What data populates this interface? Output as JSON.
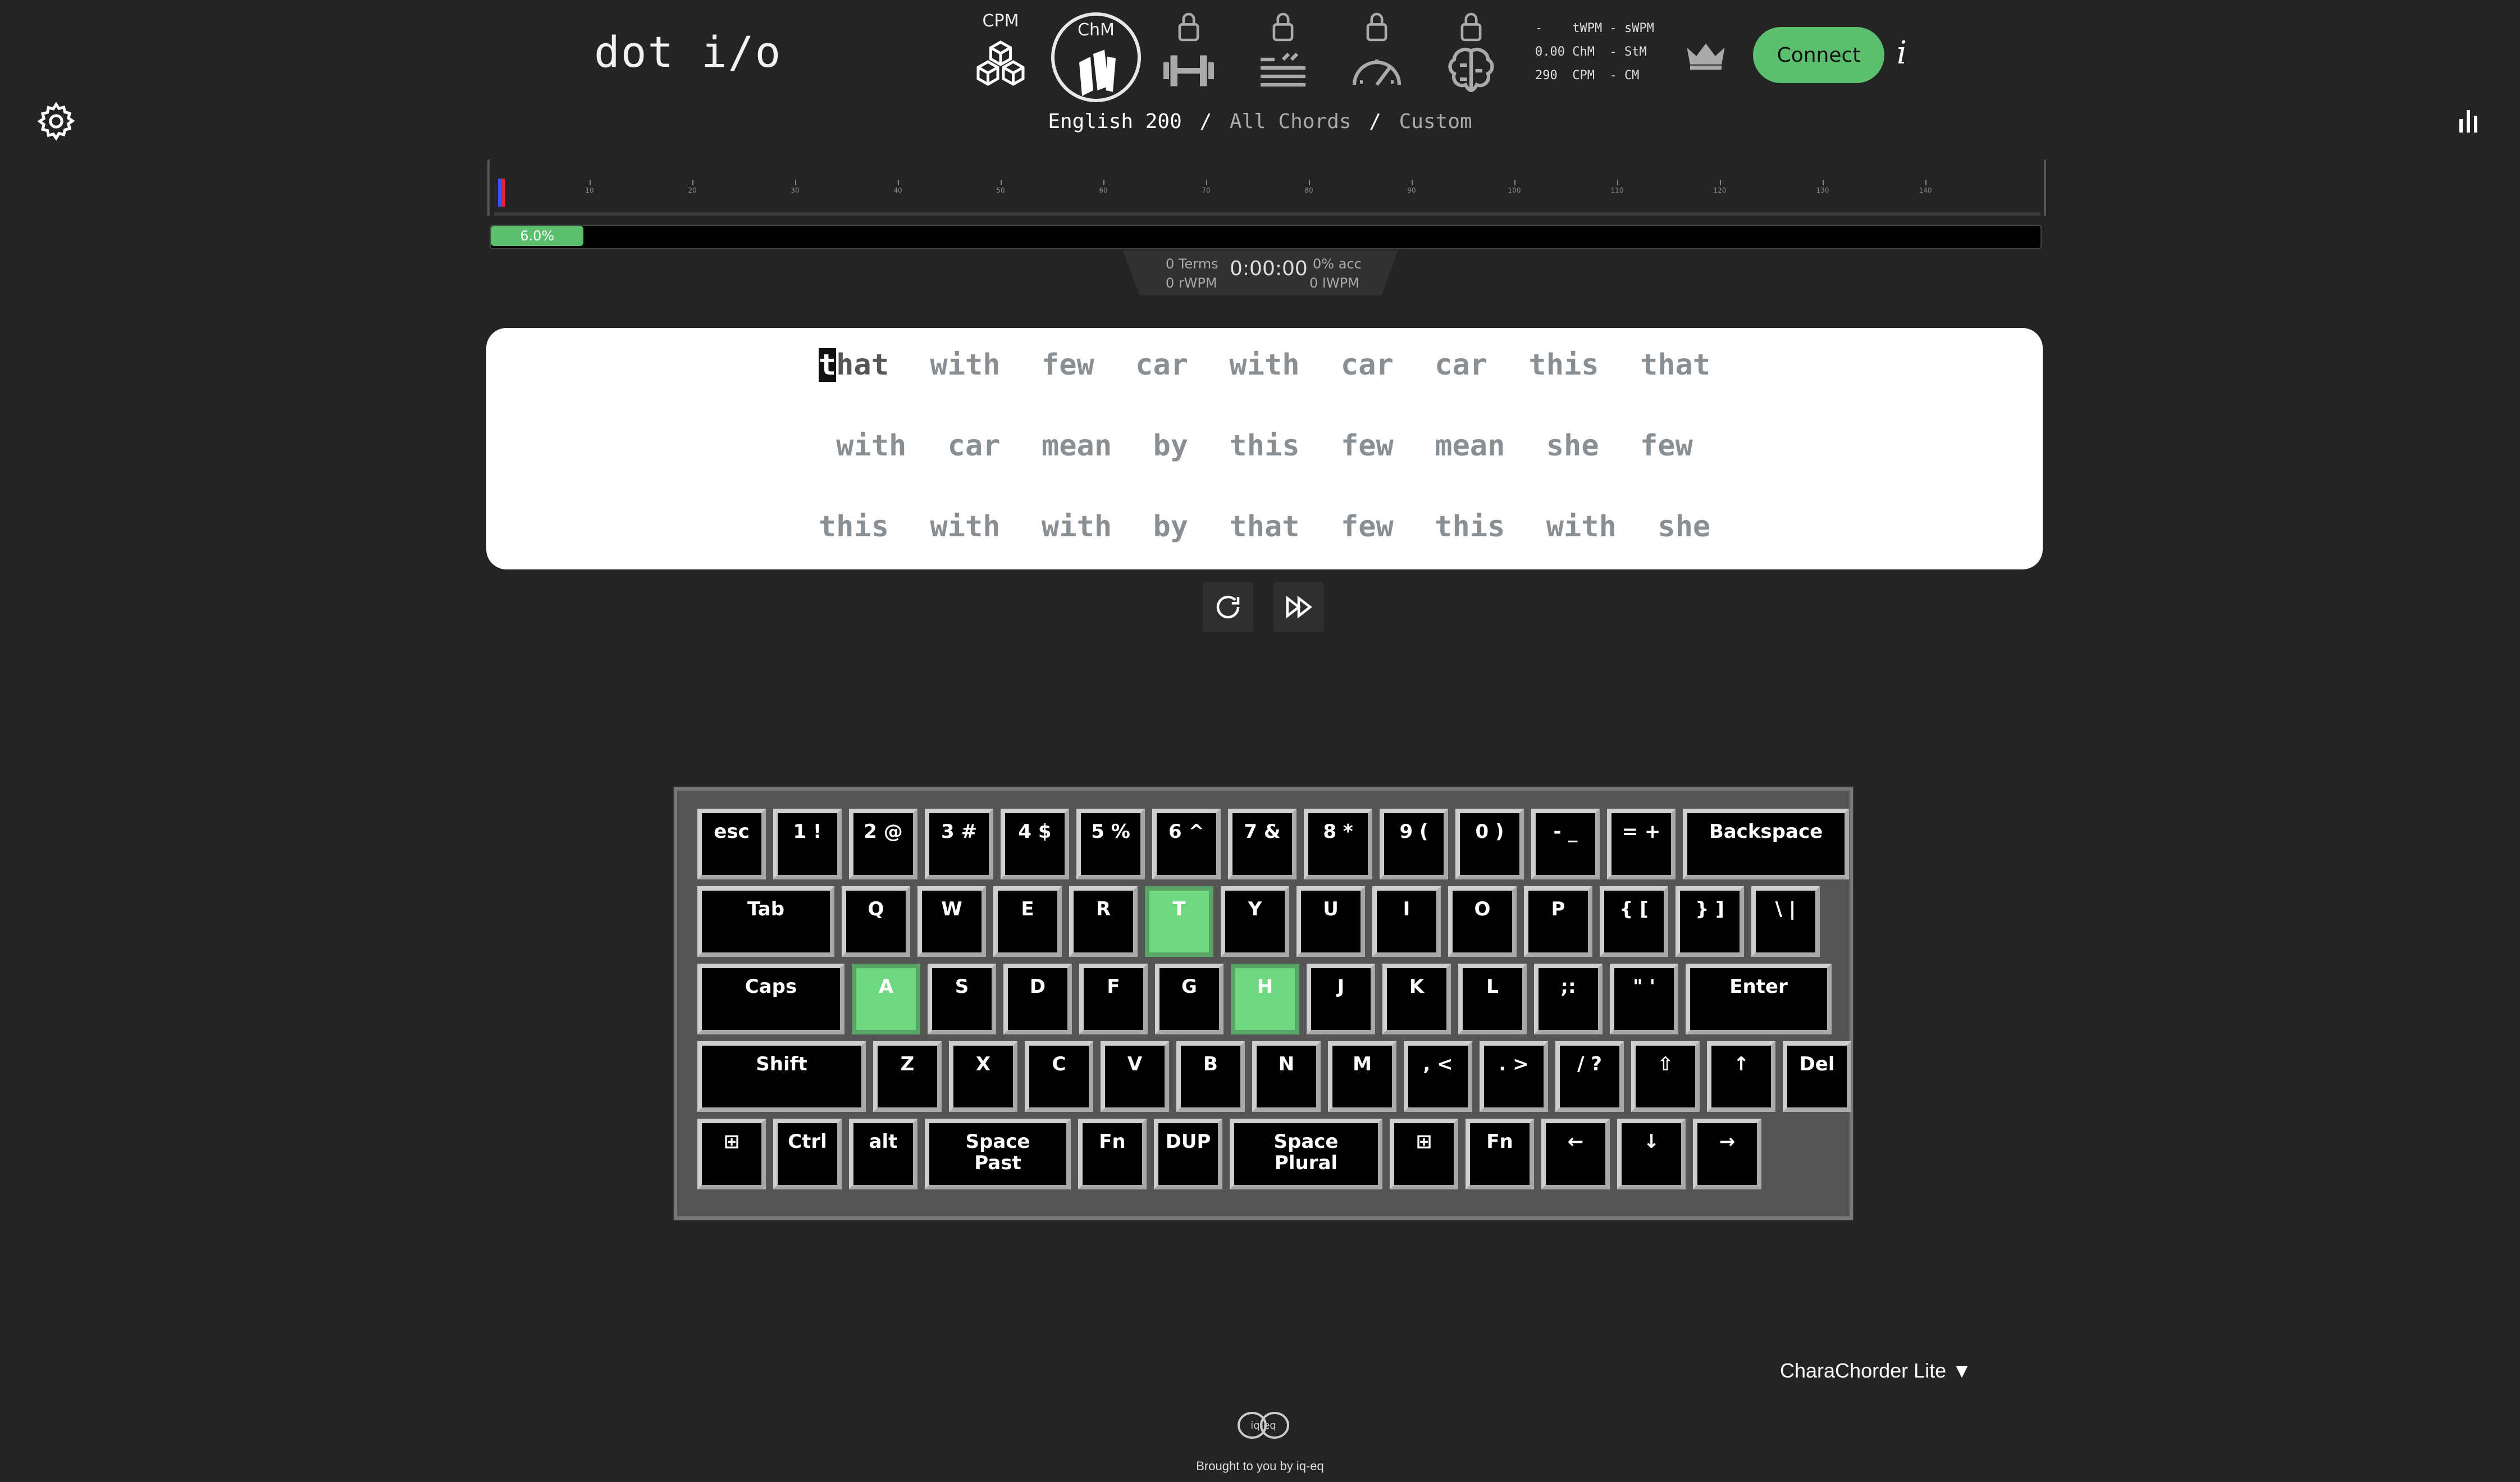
{
  "app": {
    "logo": "dot i/o"
  },
  "modes": [
    {
      "label": "CPM",
      "icon": "cubes-icon",
      "active": false,
      "locked": false
    },
    {
      "label": "ChM",
      "icon": "books-icon",
      "active": true,
      "locked": false
    },
    {
      "label": "",
      "icon": "dumbbell-icon",
      "locked": true
    },
    {
      "label": "",
      "icon": "lines-icon",
      "locked": true
    },
    {
      "label": "",
      "icon": "speedometer-icon",
      "locked": true
    },
    {
      "label": "",
      "icon": "brain-icon",
      "locked": true
    }
  ],
  "mini_stats": {
    "line1": "-    tWPM - sWPM",
    "line2": "0.00 ChM  - StM",
    "line3": "290  CPM  - CM"
  },
  "header": {
    "connect_label": "Connect",
    "info_label": "i"
  },
  "breadcrumbs": {
    "item1": "English 200",
    "item2": "All Chords",
    "item3": "Custom",
    "sep": "/"
  },
  "ruler": {
    "labels": [
      "10",
      "20",
      "30",
      "40",
      "50",
      "60",
      "70",
      "80",
      "90",
      "100",
      "110",
      "120",
      "130",
      "140"
    ]
  },
  "progress": {
    "value_percent": 6.0,
    "label": "6.0%"
  },
  "session": {
    "terms": "0 Terms",
    "rwpm": "0 rWPM",
    "timer": "0:00:00",
    "acc": "0% acc",
    "iwpm": "0 IWPM"
  },
  "prompt": {
    "first_char": "t",
    "first_rest": "hat",
    "row1_rest": [
      "with",
      "few",
      "car",
      "with",
      "car",
      "car",
      "this",
      "that"
    ],
    "row2": [
      "with",
      "car",
      "mean",
      "by",
      "this",
      "few",
      "mean",
      "she",
      "few"
    ],
    "row3": [
      "this",
      "with",
      "with",
      "by",
      "that",
      "few",
      "this",
      "with",
      "she"
    ]
  },
  "keyboard": {
    "highlight_color": "#6fd982",
    "rows": [
      [
        "esc",
        "1 !",
        "2 @",
        "3 #",
        "4 $",
        "5 %",
        "6 ^",
        "7 &",
        "8 *",
        "9 (",
        "0 )",
        "- _",
        "= +",
        "Backspace"
      ],
      [
        "Tab",
        "Q",
        "W",
        "E",
        "R",
        "T",
        "Y",
        "U",
        "I",
        "O",
        "P",
        "{ [",
        "} ]",
        "\\ |"
      ],
      [
        "Caps",
        "A",
        "S",
        "D",
        "F",
        "G",
        "H",
        "J",
        "K",
        "L",
        ";:",
        "\" '",
        "Enter"
      ],
      [
        "Shift",
        "Z",
        "X",
        "C",
        "V",
        "B",
        "N",
        "M",
        ", <",
        ". >",
        "/ ?",
        "⇧",
        "↑",
        "Del"
      ],
      [
        "⊞",
        "Ctrl",
        "alt",
        "Space\nPast",
        "Fn",
        "DUP",
        "Space\nPlural",
        "⊞",
        "Fn",
        "←",
        "↓",
        "→"
      ]
    ],
    "highlighted": [
      "T",
      "A",
      "H"
    ]
  },
  "footer": {
    "device": "CharaChorder Lite ▼",
    "logo_text": "iq-eq",
    "credit": "Brought to you by iq-eq"
  },
  "colors": {
    "bg": "#232423",
    "accent": "#5bbf6e",
    "panel": "#ffffff"
  }
}
